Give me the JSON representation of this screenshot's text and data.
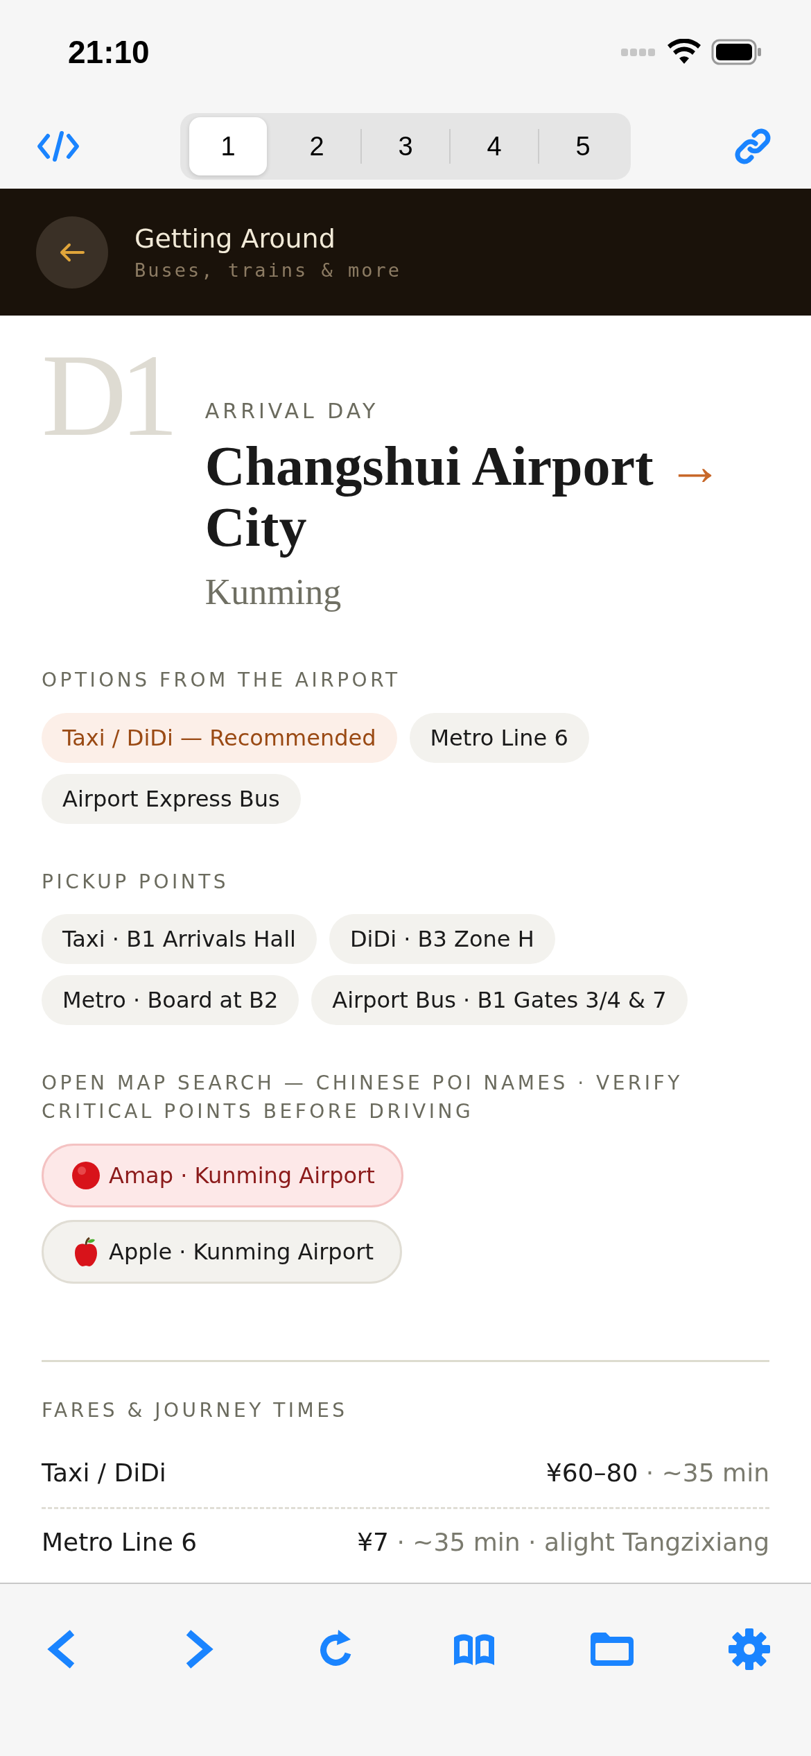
{
  "status_bar": {
    "time": "21:10"
  },
  "segments": [
    {
      "label": "1",
      "selected": true
    },
    {
      "label": "2",
      "selected": false
    },
    {
      "label": "3",
      "selected": false
    },
    {
      "label": "4",
      "selected": false
    },
    {
      "label": "5",
      "selected": false
    }
  ],
  "header": {
    "title": "Getting Around",
    "subtitle": "Buses, trains & more"
  },
  "day": {
    "badge": "D1",
    "eyebrow": "ARRIVAL DAY",
    "title": "Changshui Airport",
    "arrow": "→",
    "title_end": "City",
    "city": "Kunming"
  },
  "sections": [
    {
      "label": "OPTIONS FROM THE AIRPORT",
      "chips": [
        {
          "text": "Taxi / DiDi — Recommended",
          "kind": "highlight"
        },
        {
          "text": "Metro Line 6",
          "kind": "plain"
        },
        {
          "text": "Airport Express Bus",
          "kind": "plain"
        }
      ]
    },
    {
      "label": "PICKUP POINTS",
      "chips": [
        {
          "text": "Taxi · B1 Arrivals Hall",
          "kind": "plain"
        },
        {
          "text": "DiDi · B3 Zone H",
          "kind": "plain"
        },
        {
          "text": "Metro · Board at B2",
          "kind": "plain"
        },
        {
          "text": "Airport Bus · B1 Gates 3/4 & 7",
          "kind": "plain"
        }
      ]
    },
    {
      "label": "OPEN MAP SEARCH — CHINESE POI NAMES · VERIFY CRITICAL POINTS BEFORE DRIVING",
      "chips": [
        {
          "text": "Amap · Kunming Airport",
          "kind": "amap"
        },
        {
          "text": "Apple · Kunming Airport",
          "kind": "apple"
        }
      ]
    }
  ],
  "fares": {
    "label": "FARES & JOURNEY TIMES",
    "rows": [
      {
        "mode": "Taxi / DiDi",
        "price": "¥60–80",
        "detail": "· ~35 min"
      },
      {
        "mode": "Metro Line 6",
        "price": "¥7",
        "detail": "· ~35 min · alight Tangzixiang"
      }
    ]
  }
}
